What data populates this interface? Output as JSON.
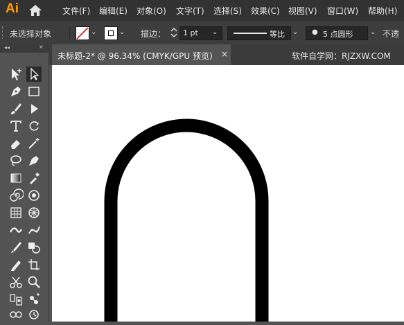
{
  "app": {
    "logo": "Ai"
  },
  "menu": [
    "文件(F)",
    "编辑(E)",
    "对象(O)",
    "文字(T)",
    "选择(S)",
    "效果(C)",
    "视图(V)",
    "窗口(W)",
    "帮助(H)"
  ],
  "control": {
    "selection_status": "未选择对象",
    "stroke_label": "描边",
    "stroke_weight": "1 pt",
    "profile_label": "等比",
    "brush_label": "5 点圆形",
    "opacity_label": "不透"
  },
  "document": {
    "tab_title": "未标题-2* @ 96.34% (CMYK/GPU 预览)",
    "close": "×"
  },
  "watermark": "软件自学网：RJZXW.COM",
  "canvas": {
    "shape": "arch",
    "stroke_color": "#000000",
    "background": "#ffffff"
  },
  "tools": [
    "selection-icon",
    "direct-selection-icon",
    "pen-icon",
    "rectangle-icon",
    "paintbrush-icon",
    "shaper-icon",
    "type-icon",
    "rotate-icon",
    "eraser-icon",
    "magic-wand-icon",
    "lasso-icon",
    "curvature-icon",
    "gradient-icon",
    "eyedropper-icon",
    "spiral-icon",
    "symbol-sprayer-icon",
    "mesh-icon",
    "perspective-grid-icon",
    "width-icon",
    "puppet-warp-icon",
    "blob-brush-icon",
    "shape-builder-icon",
    "pencil-icon",
    "artboard-icon",
    "scissors-icon",
    "zoom-icon",
    "slice-icon",
    "live-paint-icon",
    "blend-icon",
    "hand-icon"
  ]
}
